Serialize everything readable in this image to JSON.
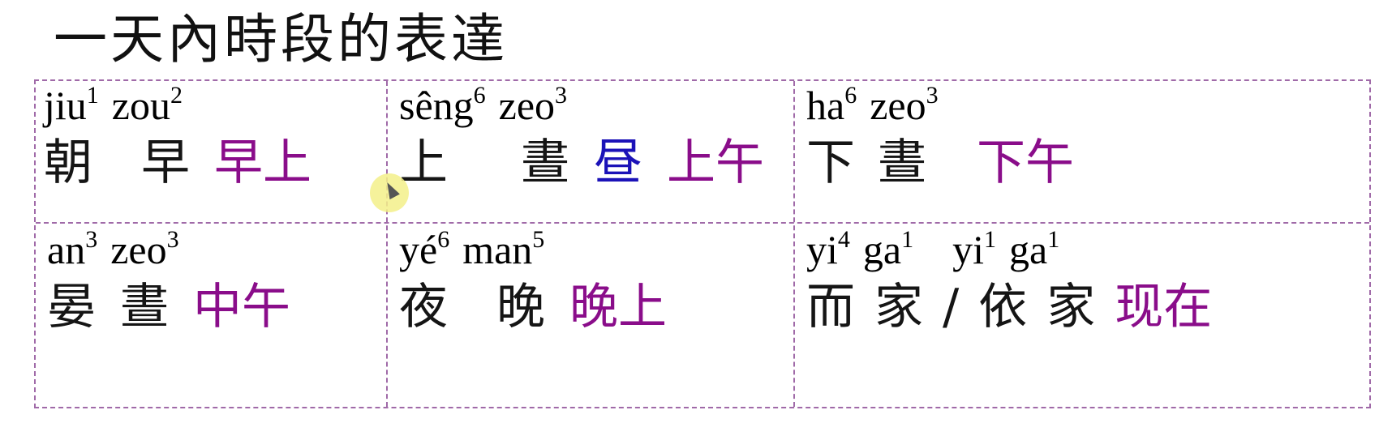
{
  "title": "一天內時段的表達",
  "cells": [
    {
      "roman": [
        {
          "syl": "jiu",
          "tone": "1"
        },
        {
          "syl": "zou",
          "tone": "2"
        }
      ],
      "chars": [
        "朝",
        "早"
      ],
      "gloss": [
        {
          "text": "早上",
          "color": "purple"
        }
      ]
    },
    {
      "roman": [
        {
          "syl": "sêng",
          "tone": "6"
        },
        {
          "syl": "zeo",
          "tone": "3"
        }
      ],
      "chars": [
        "上",
        "晝"
      ],
      "gloss": [
        {
          "text": "昼",
          "color": "blue"
        },
        {
          "text": "上午",
          "color": "purple"
        }
      ]
    },
    {
      "roman": [
        {
          "syl": "ha",
          "tone": "6"
        },
        {
          "syl": "zeo",
          "tone": "3"
        }
      ],
      "chars": [
        "下",
        "晝"
      ],
      "gloss": [
        {
          "text": "下午",
          "color": "purple"
        }
      ]
    },
    {
      "roman": [
        {
          "syl": "an",
          "tone": "3"
        },
        {
          "syl": "zeo",
          "tone": "3"
        }
      ],
      "chars": [
        "晏",
        "晝"
      ],
      "gloss": [
        {
          "text": "中午",
          "color": "purple"
        }
      ]
    },
    {
      "roman": [
        {
          "syl": "yé",
          "tone": "6"
        },
        {
          "syl": "man",
          "tone": "5"
        }
      ],
      "chars": [
        "夜",
        "晚"
      ],
      "gloss": [
        {
          "text": "晚上",
          "color": "purple"
        }
      ]
    },
    {
      "roman": [
        {
          "syl": "yi",
          "tone": "4"
        },
        {
          "syl": "ga",
          "tone": "1"
        },
        {
          "syl": "yi",
          "tone": "1"
        },
        {
          "syl": "ga",
          "tone": "1"
        }
      ],
      "chars": [
        "而",
        "家",
        "/",
        "依",
        "家"
      ],
      "gloss": [
        {
          "text": "现在",
          "color": "purple"
        }
      ]
    }
  ],
  "colors": {
    "purple": "#8a0d8a",
    "blue": "#1b12b8",
    "border": "#a06aa8"
  },
  "icons": [
    "mouse-cursor-icon"
  ]
}
